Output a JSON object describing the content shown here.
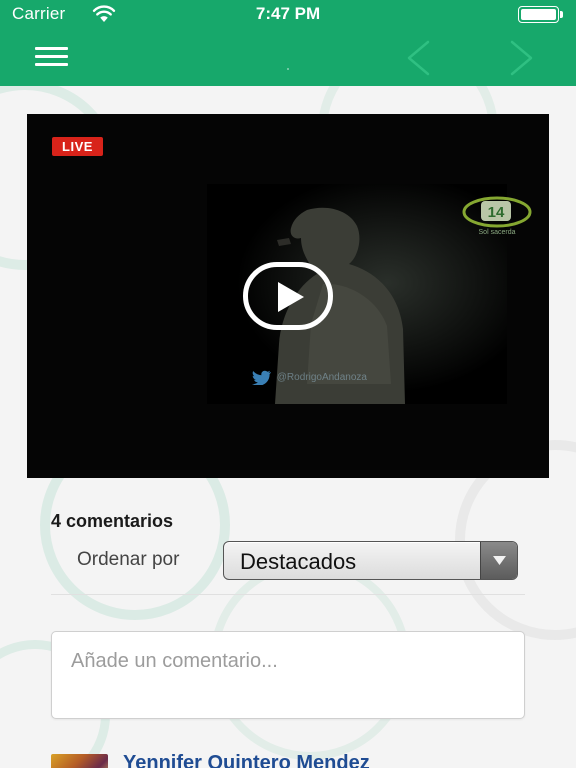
{
  "status_bar": {
    "carrier": "Carrier",
    "time": "7:47 PM"
  },
  "nav_bar": {
    "background_color": "#17a86b",
    "icons": [
      "menu-icon",
      "chevron-left-icon",
      "chevron-right-icon"
    ]
  },
  "video": {
    "live_label": "LIVE",
    "twitter_handle": "@RodrigoAndanoza",
    "channel_logo_text": "14",
    "channel_logo_subtext": "Sol sacerda"
  },
  "comments": {
    "count_label": "4 comentarios",
    "sort_label": "Ordenar por",
    "sort_value": "Destacados",
    "input_placeholder": "Añade un comentario...",
    "items": [
      {
        "author": "Yennifer Quintero Mendez"
      }
    ]
  },
  "colors": {
    "brand": "#17a86b",
    "live": "#d8231a",
    "author_link": "#1f4c93"
  }
}
